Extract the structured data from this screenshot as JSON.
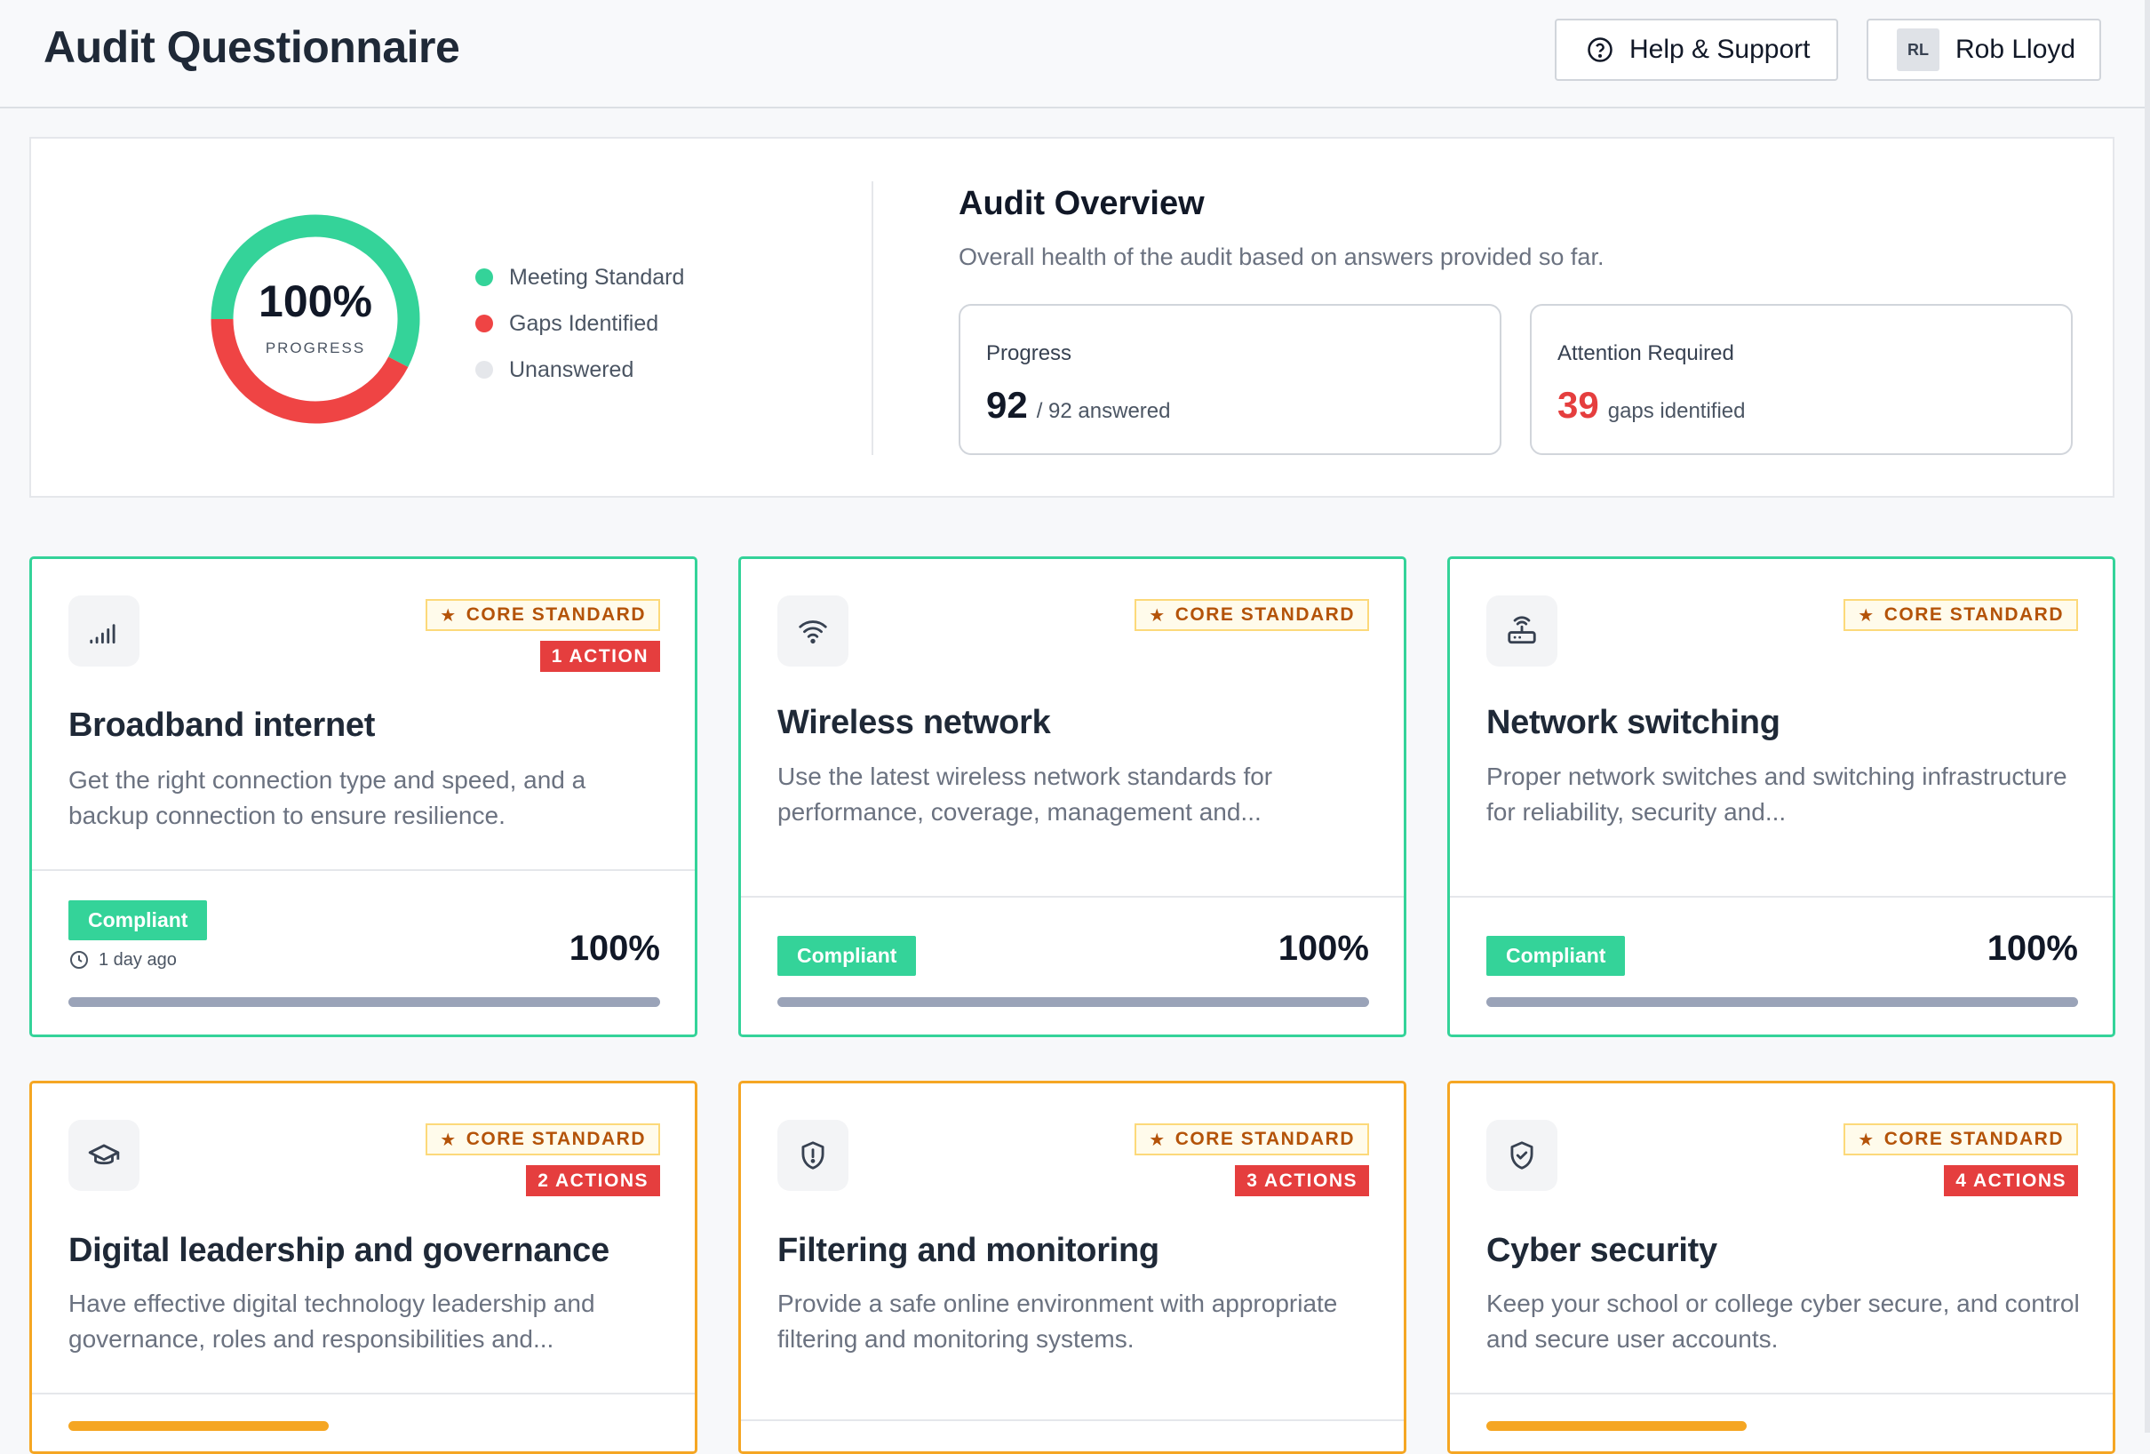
{
  "header": {
    "title": "Audit Questionnaire",
    "help_label": "Help & Support",
    "user_initials": "RL",
    "user_name": "Rob Lloyd"
  },
  "overview": {
    "progress_percent_label": "100%",
    "progress_caption": "PROGRESS",
    "donut": {
      "meeting_fraction": 0.576,
      "gaps_fraction": 0.424,
      "unanswered_fraction": 0.0
    },
    "legend": [
      {
        "label": "Meeting Standard",
        "color": "#34d399"
      },
      {
        "label": "Gaps Identified",
        "color": "#ef4444"
      },
      {
        "label": "Unanswered",
        "color": "#e5e7eb"
      }
    ],
    "title": "Audit Overview",
    "subtitle": "Overall health of the audit based on answers provided so far.",
    "progress_box": {
      "label": "Progress",
      "value": "92",
      "suffix": "/ 92 answered"
    },
    "attention_box": {
      "label": "Attention Required",
      "value": "39",
      "suffix": "gaps identified"
    }
  },
  "colors": {
    "compliant": "#34d399",
    "warning": "#f5a623",
    "danger": "#e53e3e"
  },
  "cards": [
    {
      "icon": "signal-bars-icon",
      "core_label": "CORE STANDARD",
      "action_label": "1 ACTION",
      "title": "Broadband internet",
      "description": "Get the right connection type and speed, and a backup connection to ensure resilience.",
      "status": "Compliant",
      "updated": "1 day ago",
      "percent_label": "100%",
      "progress": 1.0
    },
    {
      "icon": "wifi-icon",
      "core_label": "CORE STANDARD",
      "action_label": "",
      "title": "Wireless network",
      "description": "Use the latest wireless network standards for performance, coverage, management and...",
      "status": "Compliant",
      "updated": "",
      "percent_label": "100%",
      "progress": 1.0
    },
    {
      "icon": "router-icon",
      "core_label": "CORE STANDARD",
      "action_label": "",
      "title": "Network switching",
      "description": "Proper network switches and switching infrastructure for reliability, security and...",
      "status": "Compliant",
      "updated": "",
      "percent_label": "100%",
      "progress": 1.0
    },
    {
      "icon": "graduation-cap-icon",
      "core_label": "CORE STANDARD",
      "action_label": "2 ACTIONS",
      "title": "Digital leadership and governance",
      "description": "Have effective digital technology leadership and governance, roles and responsibilities and...",
      "status": "",
      "updated": "",
      "percent_label": "",
      "progress": 0.44
    },
    {
      "icon": "shield-alert-icon",
      "core_label": "CORE STANDARD",
      "action_label": "3 ACTIONS",
      "title": "Filtering and monitoring",
      "description": "Provide a safe online environment with appropriate filtering and monitoring systems.",
      "status": "",
      "updated": "",
      "percent_label": "",
      "progress": 0.0
    },
    {
      "icon": "shield-check-icon",
      "core_label": "CORE STANDARD",
      "action_label": "4 ACTIONS",
      "title": "Cyber security",
      "description": "Keep your school or college cyber secure, and control and secure user accounts.",
      "status": "",
      "updated": "",
      "percent_label": "",
      "progress": 0.44
    }
  ]
}
